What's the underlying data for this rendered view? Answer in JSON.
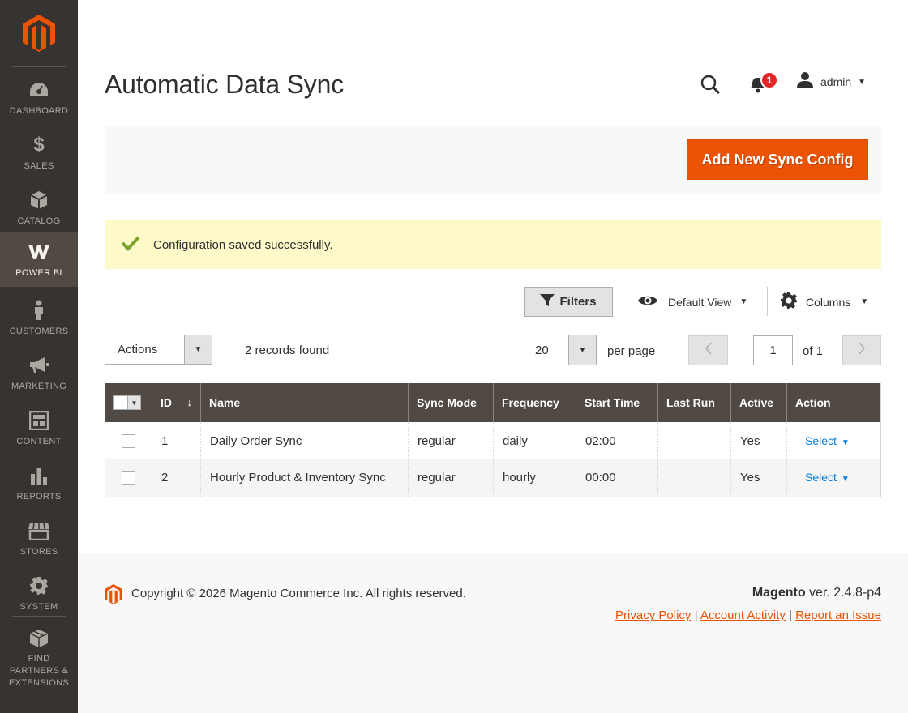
{
  "sidebar": {
    "items": [
      {
        "label": "DASHBOARD",
        "icon": "dashboard-icon"
      },
      {
        "label": "SALES",
        "icon": "dollar-icon"
      },
      {
        "label": "CATALOG",
        "icon": "cube-icon"
      },
      {
        "label": "POWER BI",
        "icon": "powerbi-icon",
        "active": true
      },
      {
        "label": "CUSTOMERS",
        "icon": "person-icon"
      },
      {
        "label": "MARKETING",
        "icon": "megaphone-icon"
      },
      {
        "label": "CONTENT",
        "icon": "layout-icon"
      },
      {
        "label": "REPORTS",
        "icon": "bar-chart-icon"
      },
      {
        "label": "STORES",
        "icon": "store-icon"
      },
      {
        "label": "SYSTEM",
        "icon": "gear-icon"
      },
      {
        "label": "FIND PARTNERS & EXTENSIONS",
        "icon": "boxes-icon"
      }
    ]
  },
  "header": {
    "title": "Automatic Data Sync",
    "notification_count": "1",
    "user": "admin"
  },
  "actions": {
    "add_button": "Add New Sync Config"
  },
  "message": {
    "text": "Configuration saved successfully."
  },
  "grid_controls": {
    "filters": "Filters",
    "default_view": "Default View",
    "columns": "Columns",
    "mass_actions": "Actions",
    "records_found": "2 records found",
    "per_page_value": "20",
    "per_page_label": "per page",
    "current_page": "1",
    "page_of": "of 1"
  },
  "table": {
    "columns": [
      "ID",
      "Name",
      "Sync Mode",
      "Frequency",
      "Start Time",
      "Last Run",
      "Active",
      "Action"
    ],
    "sort_indicator": "↓",
    "rows": [
      {
        "id": "1",
        "name": "Daily Order Sync",
        "sync_mode": "regular",
        "frequency": "daily",
        "start_time": "02:00",
        "last_run": "",
        "active": "Yes",
        "action": "Select"
      },
      {
        "id": "2",
        "name": "Hourly Product & Inventory Sync",
        "sync_mode": "regular",
        "frequency": "hourly",
        "start_time": "00:00",
        "last_run": "",
        "active": "Yes",
        "action": "Select"
      }
    ]
  },
  "footer": {
    "copyright": "Copyright © 2026 Magento Commerce Inc. All rights reserved.",
    "brand": "Magento",
    "version": " ver. 2.4.8-p4",
    "links": [
      "Privacy Policy",
      "Account Activity",
      "Report an Issue"
    ]
  },
  "colors": {
    "accent": "#eb5202",
    "sidebar_bg": "#373330",
    "sidebar_active": "#514943",
    "table_header": "#514943",
    "message_bg": "#fdf9c9",
    "link": "#007bdb"
  }
}
